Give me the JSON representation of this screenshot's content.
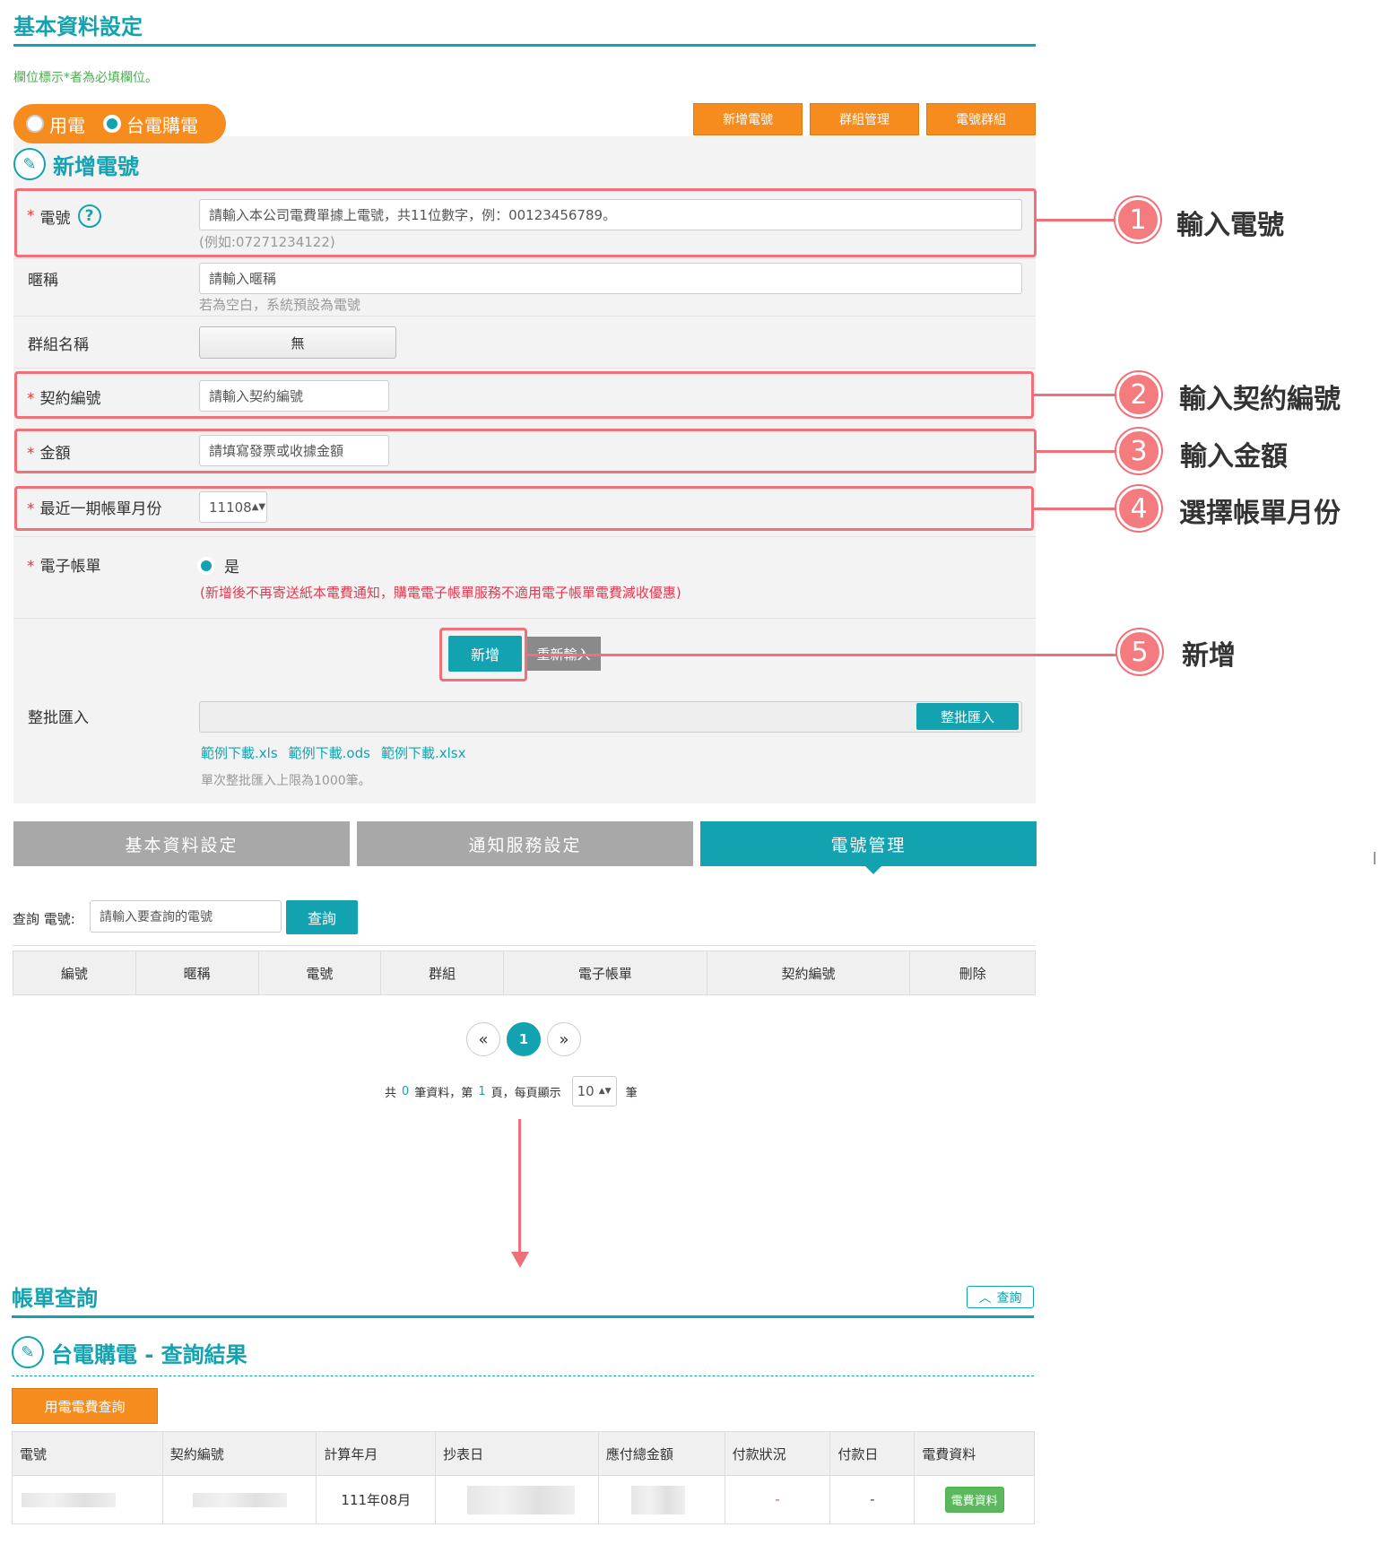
{
  "page_title": "基本資料設定",
  "required_note": "欄位標示*者為必填欄位。",
  "meter_type": {
    "option1": "用電",
    "option2": "台電購電"
  },
  "top_buttons": {
    "add": "新增電號",
    "group": "群組管理",
    "meter_group": "電號群組"
  },
  "section_title": "新增電號",
  "form": {
    "phone_label": "電號",
    "phone_placeholder": "請輸入本公司電費單據上電號，共11位數字，例：00123456789。",
    "phone_hint": "(例如:07271234122)",
    "nickname_label": "暱稱",
    "nickname_placeholder": "請輸入暱稱",
    "nickname_hint": "若為空白，系統預設為電號",
    "group_label": "群組名稱",
    "group_value": "無",
    "contract_label": "契約編號",
    "contract_placeholder": "請輸入契約編號",
    "amount_label": "金額",
    "amount_placeholder": "請填寫發票或收據金額",
    "month_label": "最近一期帳單月份",
    "month_value": "11108",
    "ebill_label": "電子帳單",
    "ebill_option": "是",
    "ebill_note": "(新增後不再寄送紙本電費通知，購電電子帳單服務不適用電子帳單電費減收優惠)",
    "add_button": "新增",
    "reset_button": "重新輸入",
    "batch_label": "整批匯入",
    "batch_button": "整批匯入",
    "sample_xls": "範例下載.xls",
    "sample_ods": "範例下載.ods",
    "sample_xlsx": "範例下載.xlsx",
    "batch_limit": "單次整批匯入上限為1000筆。"
  },
  "callouts": [
    {
      "num": "1",
      "text": "輸入電號"
    },
    {
      "num": "2",
      "text": "輸入契約編號"
    },
    {
      "num": "3",
      "text": "輸入金額"
    },
    {
      "num": "4",
      "text": "選擇帳單月份"
    },
    {
      "num": "5",
      "text": "新增"
    }
  ],
  "tabs": [
    "基本資料設定",
    "通知服務設定",
    "電號管理"
  ],
  "query": {
    "label": "查詢 電號:",
    "placeholder": "請輸入要查詢的電號",
    "button": "查詢"
  },
  "table_headers": [
    "編號",
    "暱稱",
    "電號",
    "群組",
    "電子帳單",
    "契約編號",
    "刪除"
  ],
  "pagination": {
    "current": "1",
    "total_prefix": "共",
    "total": "0",
    "mid": "筆資料，第",
    "page": "1",
    "page_suffix": "頁，每頁顯示",
    "per_page": "10",
    "unit": "筆"
  },
  "bill": {
    "title": "帳單查詢",
    "query_btn": "查詢",
    "result_title": "台電購電 - 查詢結果",
    "fee_btn": "用電電費查詢",
    "headers": [
      "電號",
      "契約編號",
      "計算年月",
      "抄表日",
      "應付總金額",
      "付款狀況",
      "付款日",
      "電費資料"
    ],
    "row": {
      "month": "111年08月",
      "status": "-",
      "paydate": "-",
      "detail_btn": "電費資料"
    }
  },
  "colors": {
    "teal": "#13a3b0",
    "orange": "#f68b1e",
    "callout": "#f0707a",
    "tab_inactive": "#a8a8a8"
  }
}
